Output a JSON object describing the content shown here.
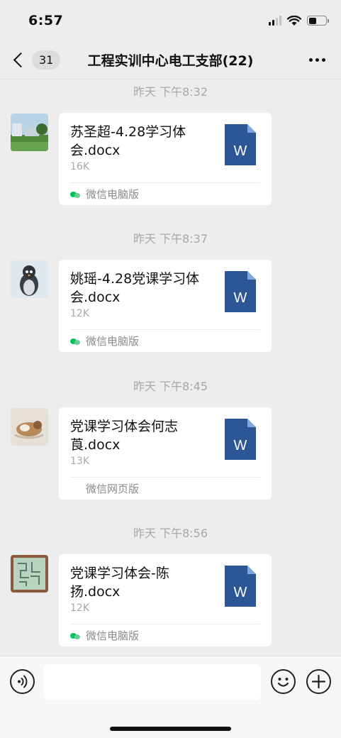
{
  "status_bar": {
    "time": "6:57"
  },
  "nav": {
    "unread_count": "31",
    "title": "工程实训中心电工支部(22)"
  },
  "messages": [
    {
      "timestamp": "昨天 下午8:32",
      "file_name": "苏圣超-4.28学习体会.docx",
      "file_size": "16K",
      "source": "微信电脑版",
      "source_icon": "pc"
    },
    {
      "timestamp": "昨天 下午8:37",
      "file_name": "姚瑶-4.28党课学习体会.docx",
      "file_size": "12K",
      "source": "微信电脑版",
      "source_icon": "pc"
    },
    {
      "timestamp": "昨天 下午8:45",
      "file_name": "党课学习体会何志莨.docx",
      "file_size": "13K",
      "source": "微信网页版",
      "source_icon": "none"
    },
    {
      "timestamp": "昨天 下午8:56",
      "file_name": "党课学习体会-陈扬.docx",
      "file_size": "12K",
      "source": "微信电脑版",
      "source_icon": "pc"
    }
  ],
  "file_icon_letter": "W",
  "colors": {
    "word_blue": "#2b5797",
    "wechat_green": "#07c160"
  },
  "input": {
    "value": ""
  }
}
